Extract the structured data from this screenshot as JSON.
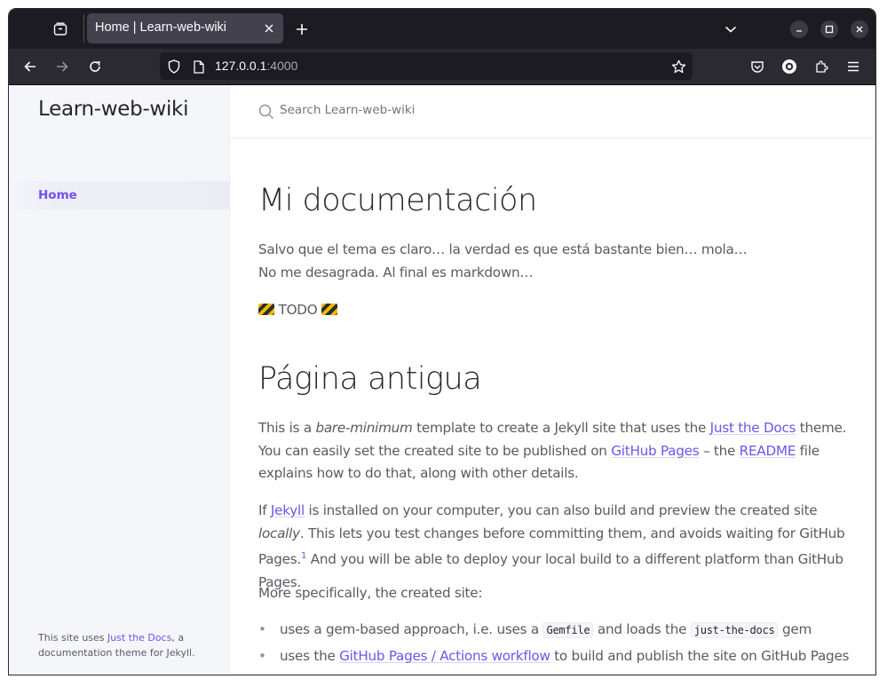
{
  "browser": {
    "tab_title": "Home | Learn-web-wiki",
    "url_host": "127.0.0.1",
    "url_port": ":4000"
  },
  "sidebar": {
    "site_title": "Learn-web-wiki",
    "nav_home": "Home",
    "footer_prefix": "This site uses ",
    "footer_link": "Just the Docs",
    "footer_suffix": ", a documentation theme for Jekyll."
  },
  "search": {
    "placeholder": "Search Learn-web-wiki"
  },
  "content": {
    "h1_a": "Mi documentación",
    "p1_line1": "Salvo que el tema es claro… la verdad es que está bastante bien… mola…",
    "p1_line2": "No me desagrada. Al final es markdown…",
    "todo": "TODO",
    "h1_b": "Página antigua",
    "p2_a": "This is a ",
    "p2_em": "bare-minimum",
    "p2_b": " template to create a Jekyll site that uses the ",
    "p2_link1": "Just the Docs",
    "p2_c": " theme. You can easily set the created site to be published on ",
    "p2_link2": "GitHub Pages",
    "p2_d": " – the ",
    "p2_link3": "README",
    "p2_e": " file explains how to do that, along with other details.",
    "p3_a": "If ",
    "p3_link1": "Jekyll",
    "p3_b": " is installed on your computer, you can also build and preview the created site ",
    "p3_em": "locally",
    "p3_c": ". This lets you test changes before committing them, and avoids waiting for GitHub Pages.",
    "p3_sup": "1",
    "p3_d": " And you will be able to deploy your local build to a different platform than GitHub Pages.",
    "p4": "More specifically, the created site:",
    "li1_a": "uses a gem-based approach, i.e. uses a ",
    "li1_code1": "Gemfile",
    "li1_b": " and loads the ",
    "li1_code2": "just-the-docs",
    "li1_c": " gem",
    "li2_a": "uses the ",
    "li2_link": "GitHub Pages / Actions workflow",
    "li2_b": " to build and publish the site on GitHub Pages"
  }
}
